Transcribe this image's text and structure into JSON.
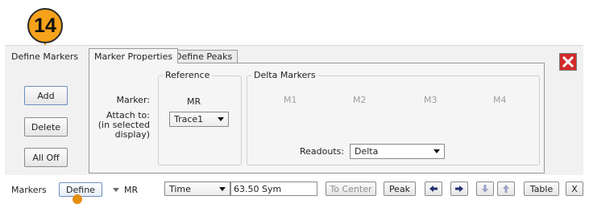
{
  "callout": {
    "number": "14"
  },
  "panel": {
    "title": "Define Markers",
    "buttons": {
      "add": "Add",
      "delete": "Delete",
      "all_off": "All Off"
    },
    "close_icon": "close-icon"
  },
  "tabs": [
    {
      "label": "Marker Properties",
      "active": true
    },
    {
      "label": "Define Peaks",
      "active": false
    }
  ],
  "reference": {
    "group_label": "Reference",
    "marker_label": "Marker:",
    "marker_value": "MR",
    "attach_label_1": "Attach to:",
    "attach_label_2": "(in selected",
    "attach_label_3": "display)",
    "attach_value": "Trace1"
  },
  "delta": {
    "group_label": "Delta Markers",
    "markers": [
      "M1",
      "M2",
      "M3",
      "M4"
    ],
    "readouts_label": "Readouts:",
    "readouts_value": "Delta"
  },
  "bottom_bar": {
    "markers_label": "Markers",
    "define_label": "Define",
    "marker_select": "MR",
    "source_select": "Time",
    "position_value": "63.50 Sym",
    "to_center": "To Center",
    "peak": "Peak",
    "table": "Table",
    "x": "X"
  },
  "colors": {
    "accent": "#f7a21b",
    "close": "#d32a2a",
    "panel_bg": "#f1f1f1"
  }
}
